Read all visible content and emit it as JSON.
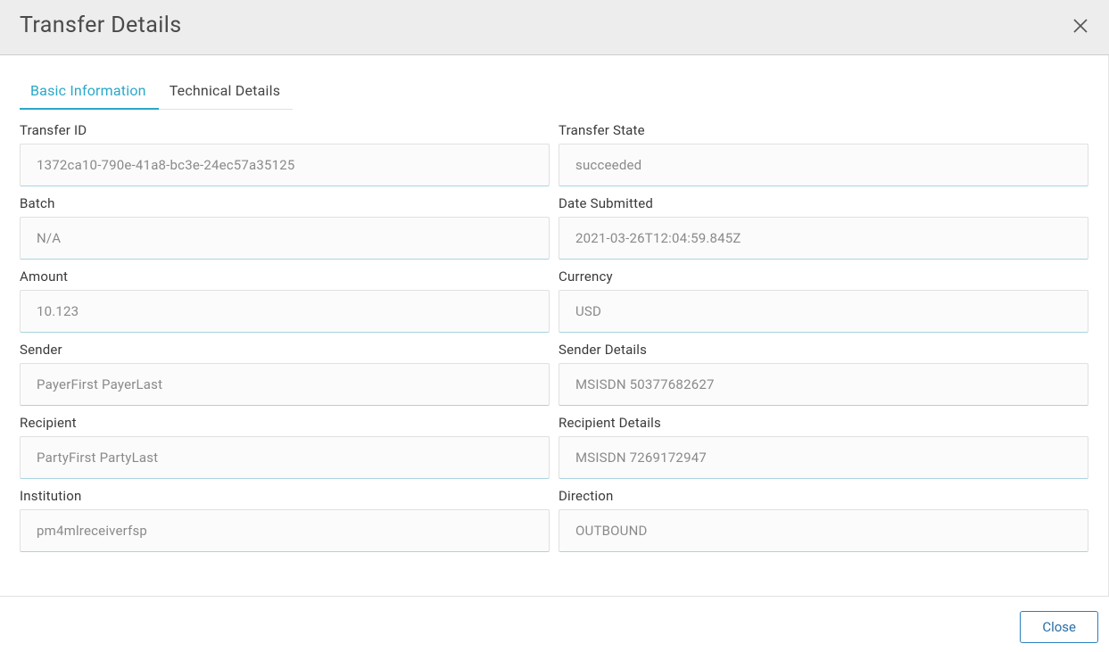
{
  "modal": {
    "title": "Transfer Details",
    "tabs": {
      "basic": "Basic Information",
      "technical": "Technical Details"
    },
    "fields": {
      "transfer_id": {
        "label": "Transfer ID",
        "value": "1372ca10-790e-41a8-bc3e-24ec57a35125"
      },
      "transfer_state": {
        "label": "Transfer State",
        "value": "succeeded"
      },
      "batch": {
        "label": "Batch",
        "value": "N/A"
      },
      "date_submitted": {
        "label": "Date Submitted",
        "value": "2021-03-26T12:04:59.845Z"
      },
      "amount": {
        "label": "Amount",
        "value": "10.123"
      },
      "currency": {
        "label": "Currency",
        "value": "USD"
      },
      "sender": {
        "label": "Sender",
        "value": "PayerFirst PayerLast"
      },
      "sender_details": {
        "label": "Sender Details",
        "value": "MSISDN 50377682627"
      },
      "recipient": {
        "label": "Recipient",
        "value": "PartyFirst PartyLast"
      },
      "recipient_details": {
        "label": "Recipient Details",
        "value": "MSISDN 7269172947"
      },
      "institution": {
        "label": "Institution",
        "value": "pm4mlreceiverfsp"
      },
      "direction": {
        "label": "Direction",
        "value": "OUTBOUND"
      }
    },
    "footer": {
      "close": "Close"
    }
  }
}
